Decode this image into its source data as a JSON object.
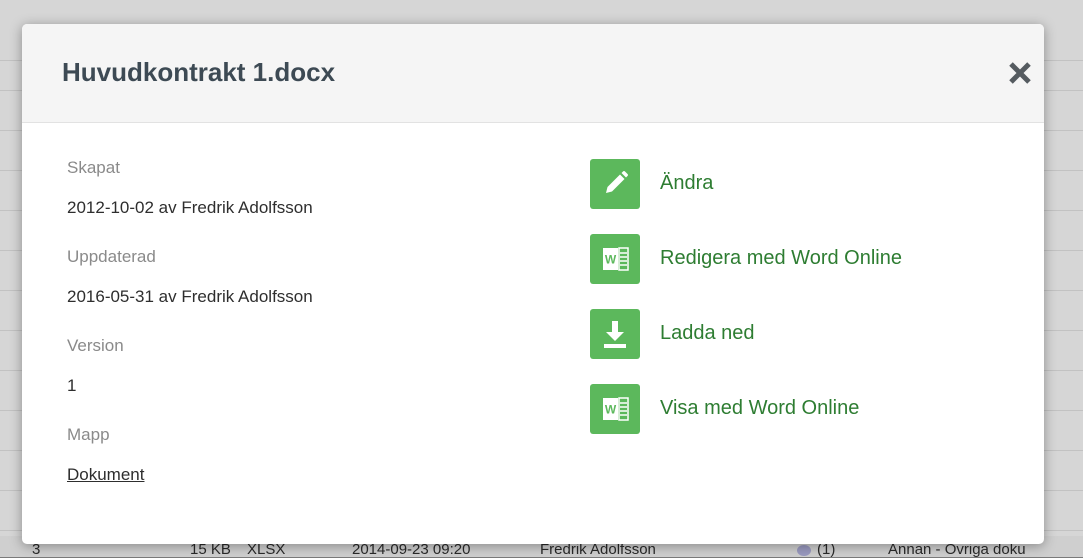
{
  "dialog": {
    "title": "Huvudkontrakt 1.docx",
    "close_icon": "close-icon"
  },
  "info": {
    "created_label": "Skapat",
    "created_value": "2012-10-02 av Fredrik Adolfsson",
    "updated_label": "Uppdaterad",
    "updated_value": "2016-05-31 av Fredrik Adolfsson",
    "version_label": "Version",
    "version_value": "1",
    "folder_label": "Mapp",
    "folder_value": "Dokument"
  },
  "actions": [
    {
      "label": "Ändra",
      "icon": "pencil-icon"
    },
    {
      "label": "Redigera med Word Online",
      "icon": "word-icon"
    },
    {
      "label": "Ladda ned",
      "icon": "download-icon"
    },
    {
      "label": "Visa med Word Online",
      "icon": "word-icon"
    }
  ],
  "background_row": {
    "col1": "3",
    "col2": "15 KB",
    "col3": "XLSX",
    "col4": "2014-09-23 09:20",
    "col5": "Fredrik Adolfsson",
    "col6": "(1)",
    "col7": "Annan - Övriga doku"
  },
  "colors": {
    "accent_green": "#5cb85c",
    "action_text": "#2e7d32",
    "title_text": "#3d4a54"
  }
}
